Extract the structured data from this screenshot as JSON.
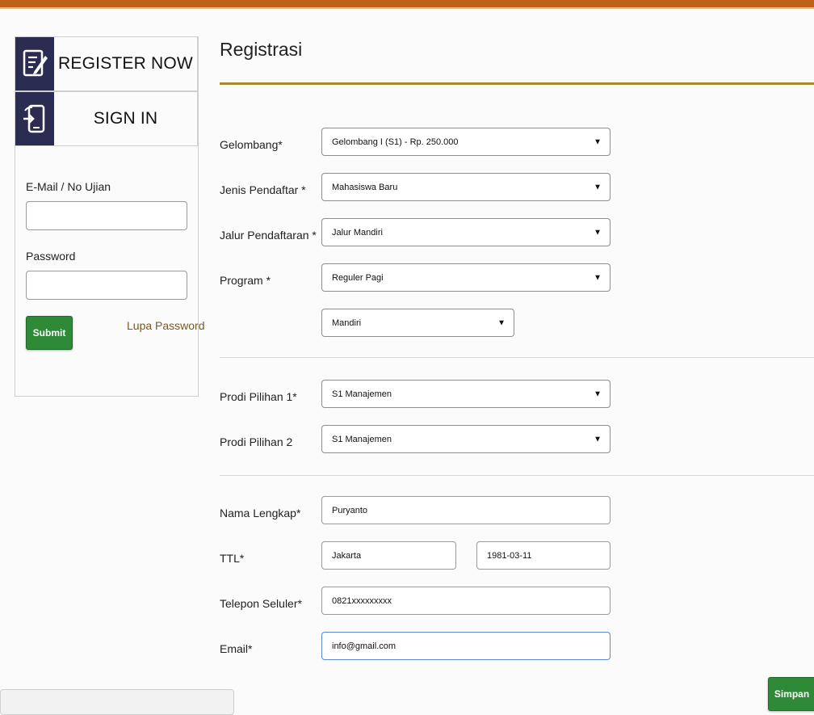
{
  "sidebar": {
    "register_label": "REGISTER NOW",
    "register_icon": "register-form-icon",
    "signin_label": "SIGN IN",
    "signin_icon": "signin-device-icon",
    "email_label": "E-Mail / No Ujian",
    "email_value": "",
    "password_label": "Password",
    "password_value": "",
    "submit_label": "Submit",
    "forgot_label": "Lupa Password"
  },
  "form": {
    "title": "Registrasi",
    "gelombang": {
      "label": "Gelombang*",
      "value": "Gelombang I (S1) - Rp. 250.000"
    },
    "jenis": {
      "label": "Jenis Pendaftar *",
      "value": "Mahasiswa Baru"
    },
    "jalur": {
      "label": "Jalur Pendaftaran *",
      "value": "Jalur Mandiri"
    },
    "program": {
      "label": "Program *",
      "value": "Reguler Pagi",
      "sub_value": "Mandiri"
    },
    "prodi1": {
      "label": "Prodi Pilihan 1*",
      "value": "S1 Manajemen"
    },
    "prodi2": {
      "label": "Prodi Pilihan 2",
      "value": "S1 Manajemen"
    },
    "nama": {
      "label": "Nama Lengkap*",
      "value": "Puryanto"
    },
    "ttl": {
      "label": "TTL*",
      "place": "Jakarta",
      "date": "1981-03-11"
    },
    "telepon": {
      "label": "Telepon Seluler*",
      "value": "0821xxxxxxxxx"
    },
    "email": {
      "label": "Email*",
      "value": "info@gmail.com"
    },
    "save_label": "Simpan"
  },
  "colors": {
    "top_bar": "#c0611a",
    "accent_rule": "#a88a2c",
    "button_green": "#2e8a37",
    "icon_bg": "#2a2c52",
    "link": "#7a5a1c"
  }
}
